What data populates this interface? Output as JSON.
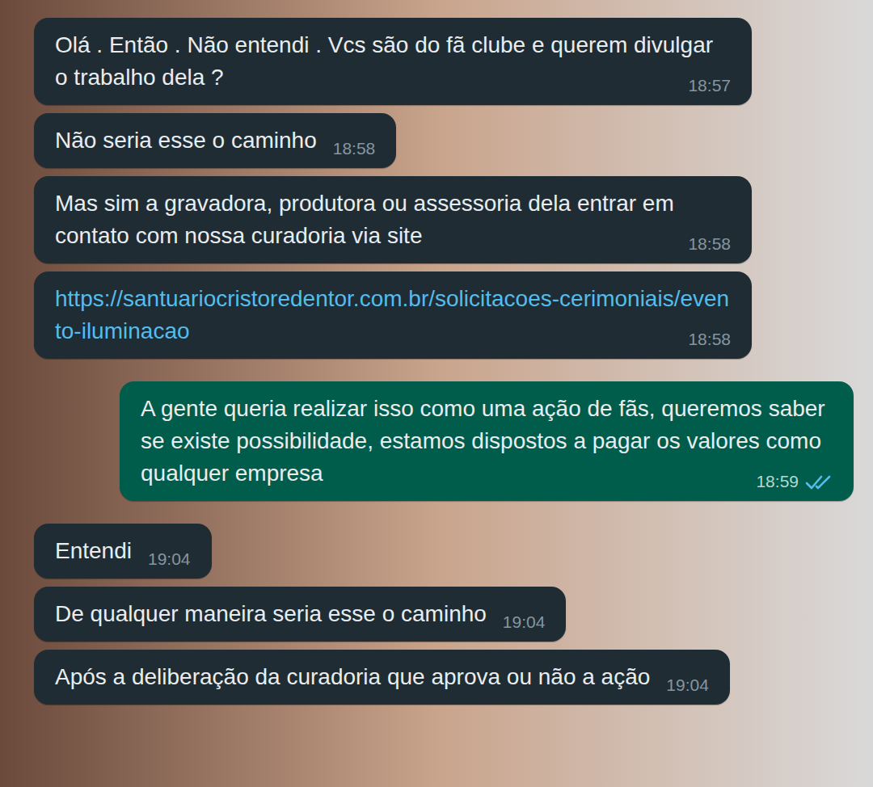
{
  "chat": {
    "messages": [
      {
        "kind": "received",
        "text": "Olá . Então . Não entendi . Vcs são do fã clube e querem divulgar o trabalho dela ?",
        "time": "18:57"
      },
      {
        "kind": "received",
        "text": "Não seria esse o caminho",
        "time": "18:58"
      },
      {
        "kind": "received",
        "text": "Mas sim a gravadora, produtora ou assessoria dela entrar em contato com nossa curadoria via site",
        "time": "18:58"
      },
      {
        "kind": "link",
        "text": "https://santuariocristoredentor.com.br/solicitacoes-cerimoniais/evento-iluminacao",
        "time": "18:58"
      },
      {
        "kind": "sent",
        "text": "A gente queria realizar isso como uma ação de fãs, queremos saber se existe possibilidade, estamos dispostos a pagar os valores como qualquer empresa",
        "time": "18:59",
        "read": true
      },
      {
        "kind": "received",
        "text": "Entendi",
        "time": "19:04"
      },
      {
        "kind": "received",
        "text": "De qualquer maneira seria esse o caminho",
        "time": "19:04"
      },
      {
        "kind": "received",
        "text": "Após a deliberação da curadoria que aprova ou não a ação",
        "time": "19:04"
      }
    ]
  }
}
